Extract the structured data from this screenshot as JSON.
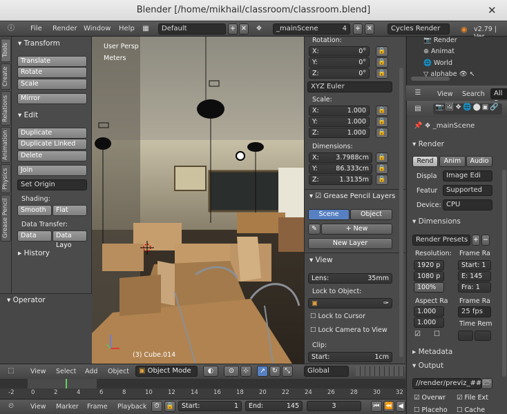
{
  "window": {
    "title": "Blender [/home/mikhail/classroom/classroom.blend]"
  },
  "info_bar": {
    "menus": [
      "File",
      "Render",
      "Window",
      "Help"
    ],
    "screen_layout": "Default",
    "scene": "_mainScene",
    "scene_users": "4",
    "render_engine": "Cycles Render",
    "version": "v2.79 | Ver"
  },
  "tool_tabs": [
    "Tools",
    "Create",
    "Relations",
    "Animation",
    "Physics",
    "Grease Pencil"
  ],
  "tool_shelf": {
    "transform": {
      "title": "Transform",
      "buttons": [
        "Translate",
        "Rotate",
        "Scale",
        "Mirror"
      ]
    },
    "edit": {
      "title": "Edit",
      "buttons": [
        "Duplicate",
        "Duplicate Linked",
        "Delete",
        "Join"
      ],
      "set_origin": "Set Origin"
    },
    "shading": {
      "label": "Shading:",
      "smooth": "Smooth",
      "flat": "Flat"
    },
    "data_transfer": {
      "label": "Data Transfer:",
      "data": "Data",
      "data_layout": "Data Layo"
    },
    "history": "History",
    "operator": "Operator"
  },
  "viewport": {
    "view_name": "User Persp",
    "units": "Meters",
    "object_label": "(3) Cube.014"
  },
  "n_panel": {
    "rotation_label": "Rotation:",
    "rotation": [
      {
        "axis": "X:",
        "value": "0°"
      },
      {
        "axis": "Y:",
        "value": "0°"
      },
      {
        "axis": "Z:",
        "value": "0°"
      }
    ],
    "rotation_mode": "XYZ Euler",
    "scale_label": "Scale:",
    "scale": [
      {
        "axis": "X:",
        "value": "1.000"
      },
      {
        "axis": "Y:",
        "value": "1.000"
      },
      {
        "axis": "Z:",
        "value": "1.000"
      }
    ],
    "dimensions_label": "Dimensions:",
    "dimensions": [
      {
        "axis": "X:",
        "value": "3.7988cm"
      },
      {
        "axis": "Y:",
        "value": "86.333cm"
      },
      {
        "axis": "Z:",
        "value": "1.3135m"
      }
    ],
    "grease_pencil": {
      "title": "Grease Pencil Layers",
      "scene_tab": "Scene",
      "object_tab": "Object",
      "new": "New",
      "new_layer": "New Layer"
    },
    "view": {
      "title": "View",
      "lens_label": "Lens:",
      "lens_value": "35mm",
      "lock_to_object": "Lock to Object:",
      "lock_to_cursor": "Lock to Cursor",
      "lock_camera": "Lock Camera to View",
      "clip_label": "Clip:",
      "clip_start_label": "Start:",
      "clip_start_value": "1cm"
    }
  },
  "outliner": {
    "items": [
      "Render",
      "Animat",
      "World",
      "alphabe"
    ]
  },
  "outliner_header": {
    "view": "View",
    "search": "Search",
    "all_scenes": "All S"
  },
  "properties": {
    "scene_name": "_mainScene",
    "render": {
      "title": "Render",
      "render_btn": "Rend",
      "anim_btn": "Anim",
      "audio_btn": "Audio",
      "display_label": "Displa",
      "display_value": "Image Edi",
      "feature_label": "Featur",
      "feature_value": "Supported",
      "device_label": "Device:",
      "device_value": "CPU"
    },
    "dimensions": {
      "title": "Dimensions",
      "presets": "Render Presets",
      "resolution_label": "Resolution:",
      "res_x": "1920 p",
      "res_y": "1080 p",
      "res_pct": "100%",
      "frame_range_label": "Frame Ra",
      "start": "Start: 1",
      "end": "E: 145",
      "frame": "Fra: 1",
      "aspect_label": "Aspect Ra",
      "aspect_x": "1.000",
      "aspect_y": "1.000",
      "frame_rate_label": "Frame Ra",
      "fps": "25 fps",
      "time_remap": "Time Rem"
    },
    "metadata": "Metadata",
    "output": {
      "title": "Output",
      "path": "//render/previz_###",
      "overwrite": "Overwr",
      "file_ext": "File Ext",
      "placeholders": "Placeho",
      "cache": "Cache"
    }
  },
  "view3d_header": {
    "menus": [
      "View",
      "Select",
      "Add",
      "Object"
    ],
    "mode": "Object Mode",
    "orientation": "Global"
  },
  "timeline": {
    "ticks": [
      "-2",
      "0",
      "2",
      "4",
      "6",
      "8",
      "10",
      "12",
      "14",
      "16",
      "18",
      "20",
      "22",
      "24",
      "26",
      "28",
      "30",
      "32"
    ],
    "current_frame_marker": 3
  },
  "timeline_header": {
    "menus": [
      "View",
      "Marker",
      "Frame",
      "Playback"
    ],
    "start_label": "Start:",
    "start": "1",
    "end_label": "End:",
    "end": "145",
    "current": "3"
  }
}
